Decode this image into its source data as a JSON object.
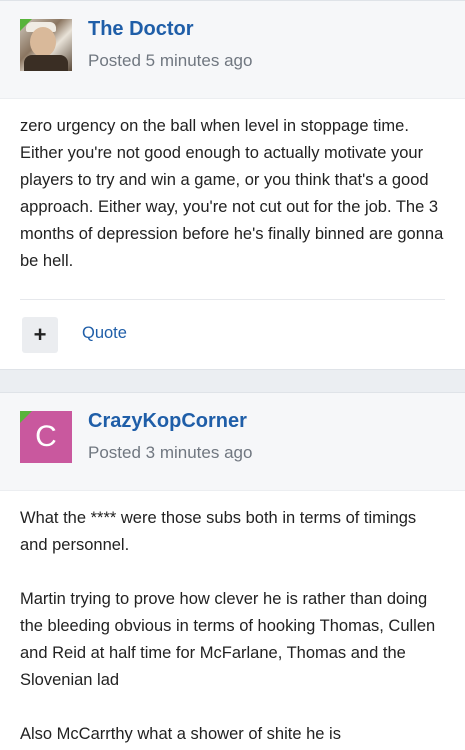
{
  "posts": [
    {
      "author": "The Doctor",
      "posted": "Posted 5 minutes ago",
      "avatar_type": "photo",
      "paragraphs": [
        "zero urgency on the ball when level in stoppage time. Either you're not good enough to actually motivate your players to try and win a game, or you think that's a good approach. Either way, you're not cut out for the job. The 3 months of depression before he's finally binned are gonna be hell."
      ],
      "plus_label": "+",
      "quote_label": "Quote"
    },
    {
      "author": "CrazyKopCorner",
      "posted": "Posted 3 minutes ago",
      "avatar_letter": "C",
      "avatar_color": "#c9589e",
      "paragraphs": [
        "What the **** were those subs both in terms of timings and personnel.",
        "Martin trying to prove how clever he is rather than doing the bleeding obvious in terms of hooking Thomas, Cullen and Reid at half time for McFarlane, Thomas and the Slovenian lad",
        "Also McCarrthy what a shower of shite he is"
      ]
    }
  ],
  "colors": {
    "author_link": "#1f5ea8",
    "online_flag": "#58b43b"
  }
}
